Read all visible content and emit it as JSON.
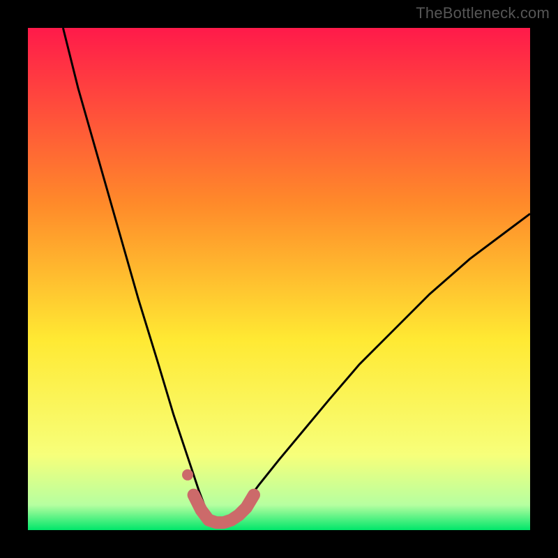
{
  "watermark": "TheBottleneck.com",
  "colors": {
    "frame": "#000000",
    "grad_top": "#ff1a4a",
    "grad_mid1": "#ff8a2a",
    "grad_mid2": "#ffe933",
    "grad_low1": "#f7ff7a",
    "grad_low2": "#b6ffa0",
    "grad_bottom": "#00e66a",
    "curve": "#000000",
    "marker": "#cc6a6a"
  },
  "chart_data": {
    "type": "line",
    "title": "",
    "xlabel": "",
    "ylabel": "",
    "xlim": [
      0,
      100
    ],
    "ylim": [
      0,
      100
    ],
    "series": [
      {
        "name": "bottleneck-curve",
        "x": [
          7,
          10,
          14,
          18,
          22,
          26,
          29,
          32,
          34,
          35.5,
          37,
          39,
          41,
          43,
          46,
          50,
          55,
          60,
          66,
          73,
          80,
          88,
          96,
          100
        ],
        "y": [
          100,
          88,
          74,
          60,
          46,
          33,
          23,
          14,
          8,
          4,
          2,
          2,
          3,
          5,
          9,
          14,
          20,
          26,
          33,
          40,
          47,
          54,
          60,
          63
        ]
      },
      {
        "name": "sweet-spot-markers",
        "x": [
          33,
          34.5,
          36,
          37.5,
          39,
          40.5,
          42,
          43.5,
          45
        ],
        "y": [
          7,
          4,
          2,
          1.5,
          1.5,
          2,
          3,
          4.5,
          7
        ]
      }
    ],
    "annotations": []
  }
}
